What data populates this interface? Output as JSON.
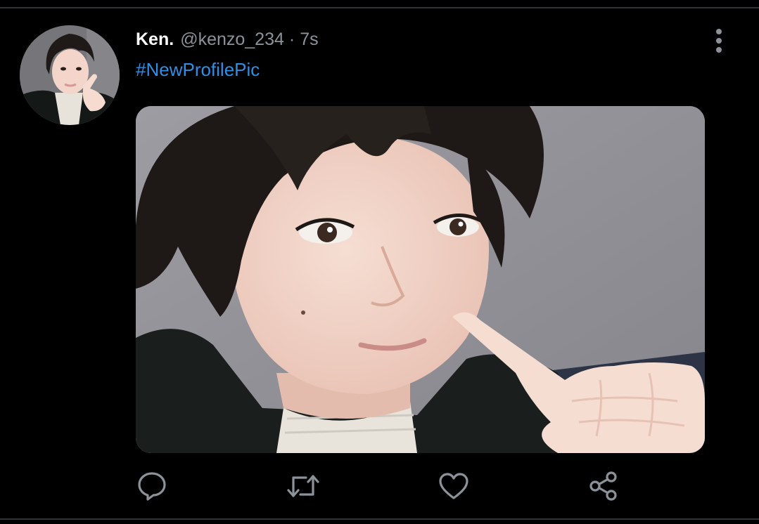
{
  "tweet": {
    "display_name": "Ken.",
    "handle": "@kenzo_234",
    "separator": "·",
    "timestamp": "7s",
    "text": "#NewProfilePic"
  },
  "icons": {
    "more": "more-vertical-icon",
    "reply": "comment-icon",
    "retweet": "retweet-icon",
    "like": "heart-icon",
    "share": "share-icon"
  },
  "colors": {
    "background": "#000000",
    "name": "#ffffff",
    "secondary": "#8b9299",
    "link": "#2f8fe5",
    "icon": "#8b9299"
  }
}
